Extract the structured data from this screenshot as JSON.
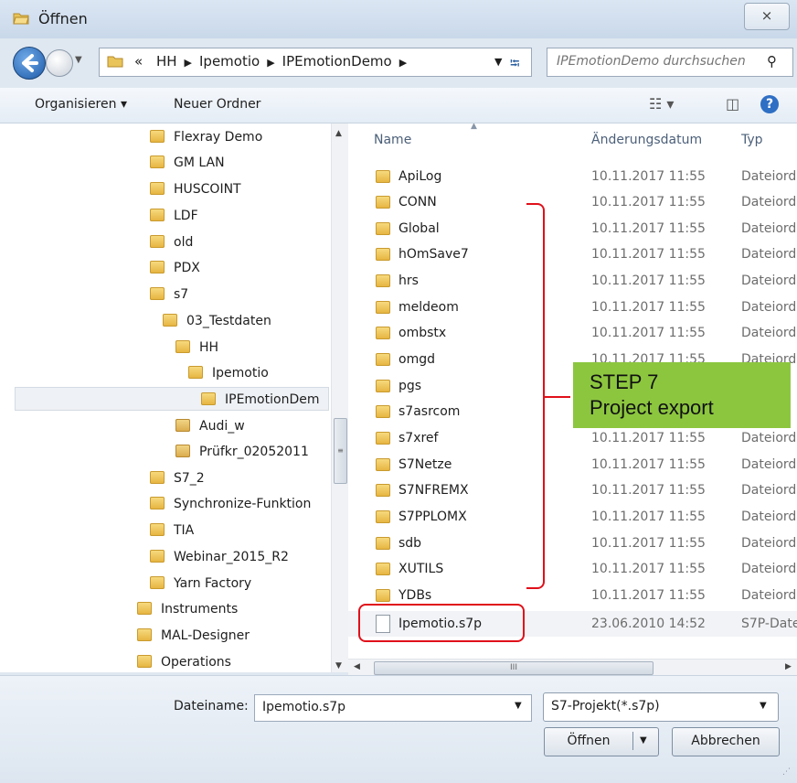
{
  "window": {
    "title": "Öffnen",
    "close_label": "⨯"
  },
  "address_bar": {
    "overflow": "«",
    "crumbs": [
      "HH",
      "Ipemotio",
      "IPEmotionDemo"
    ],
    "search_placeholder": "IPEmotionDemo durchsuchen"
  },
  "toolbar": {
    "organize_label": "Organisieren ▾",
    "new_folder_label": "Neuer Ordner"
  },
  "nav": {
    "items": [
      {
        "label": "Flexray Demo"
      },
      {
        "label": "GM LAN"
      },
      {
        "label": "HUSCOINT"
      },
      {
        "label": "LDF"
      },
      {
        "label": "old"
      },
      {
        "label": "PDX"
      },
      {
        "label": "s7"
      },
      {
        "label": "03_Testdaten"
      },
      {
        "label": "HH"
      },
      {
        "label": "Ipemotio"
      },
      {
        "label": "IPEmotionDem"
      },
      {
        "label": "Audi_w"
      },
      {
        "label": "Prüfkr_02052011"
      },
      {
        "label": "S7_2"
      },
      {
        "label": "Synchronize-Funktion"
      },
      {
        "label": "TIA"
      },
      {
        "label": "Webinar_2015_R2"
      },
      {
        "label": "Yarn Factory"
      },
      {
        "label": "Instruments"
      },
      {
        "label": "MAL-Designer"
      },
      {
        "label": "Operations"
      }
    ]
  },
  "file_list": {
    "columns": {
      "name": "Name",
      "date": "Änderungsdatum",
      "type": "Typ"
    },
    "rows": [
      {
        "name": "ApiLog",
        "date": "10.11.2017 11:55",
        "type": "Dateiord"
      },
      {
        "name": "CONN",
        "date": "10.11.2017 11:55",
        "type": "Dateiord"
      },
      {
        "name": "Global",
        "date": "10.11.2017 11:55",
        "type": "Dateiord"
      },
      {
        "name": "hOmSave7",
        "date": "10.11.2017 11:55",
        "type": "Dateiord"
      },
      {
        "name": "hrs",
        "date": "10.11.2017 11:55",
        "type": "Dateiord"
      },
      {
        "name": "meldeom",
        "date": "10.11.2017 11:55",
        "type": "Dateiord"
      },
      {
        "name": "ombstx",
        "date": "10.11.2017 11:55",
        "type": "Dateiord"
      },
      {
        "name": "omgd",
        "date": "10.11.2017 11:55",
        "type": "Dateiord"
      },
      {
        "name": "pgs",
        "date": "",
        "type": ""
      },
      {
        "name": "s7asrcom",
        "date": "",
        "type": ""
      },
      {
        "name": "s7xref",
        "date": "10.11.2017 11:55",
        "type": "Dateiord"
      },
      {
        "name": "S7Netze",
        "date": "10.11.2017 11:55",
        "type": "Dateiord"
      },
      {
        "name": "S7NFREMX",
        "date": "10.11.2017 11:55",
        "type": "Dateiord"
      },
      {
        "name": "S7PPLOMX",
        "date": "10.11.2017 11:55",
        "type": "Dateiord"
      },
      {
        "name": "sdb",
        "date": "10.11.2017 11:55",
        "type": "Dateiord"
      },
      {
        "name": "XUTILS",
        "date": "10.11.2017 11:55",
        "type": "Dateiord"
      },
      {
        "name": "YDBs",
        "date": "10.11.2017 11:55",
        "type": "Dateiord"
      }
    ],
    "file": {
      "name": "Ipemotio.s7p",
      "date": "23.06.2010 14:52",
      "type": "S7P-Date"
    }
  },
  "annotation": {
    "line1": "STEP 7",
    "line2": "Project export",
    "bracket_color": "#e0101a",
    "box_color": "#8cc63f"
  },
  "bottom": {
    "filename_label": "Dateiname:",
    "filename_value": "Ipemotio.s7p",
    "filter_value": "S7-Projekt(*.s7p)",
    "open_label": "Öffnen",
    "cancel_label": "Abbrechen"
  }
}
